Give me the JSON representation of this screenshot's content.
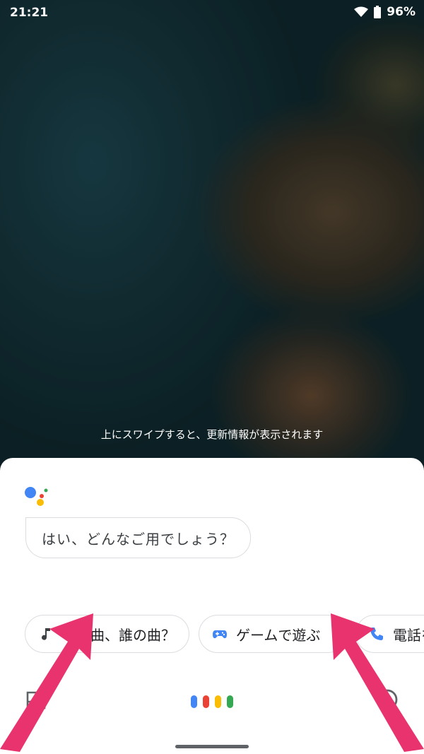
{
  "status_bar": {
    "time": "21:21",
    "battery": "96%",
    "wifi_icon": "wifi-icon",
    "battery_icon": "battery-icon"
  },
  "lock_screen": {
    "swipe_hint": "上にスワイプすると、更新情報が表示されます"
  },
  "assistant": {
    "logo_icon": "google-assistant-logo",
    "greeting": "はい、どんなご用でしょう？",
    "suggestion_chips": [
      {
        "icon": "music-note-icon",
        "label": "この曲、誰の曲？"
      },
      {
        "icon": "gamepad-icon",
        "label": "ゲームで遊ぶ"
      },
      {
        "icon": "phone-icon",
        "label": "電話を"
      }
    ],
    "bottom_bar": {
      "left_icon": "inbox-icon",
      "center": "google-mic-dots",
      "right_icon": "explore-compass-icon"
    }
  },
  "colors": {
    "google_blue": "#4285f4",
    "google_red": "#ea4335",
    "google_yellow": "#fbbc05",
    "google_green": "#34a853",
    "annotation_arrow": "#e8336e"
  }
}
